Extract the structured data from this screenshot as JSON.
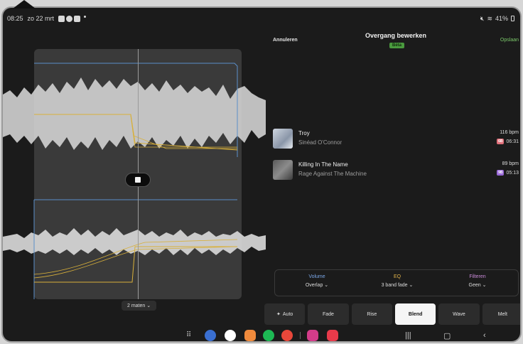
{
  "status": {
    "time": "08:25",
    "date": "zo 22 mrt",
    "battery": "41%"
  },
  "header": {
    "cancel": "Annuleren",
    "title": "Overgang bewerken",
    "beta": "Bèta",
    "save": "Opslaan"
  },
  "tracks": [
    {
      "title": "Troy",
      "artist": "Sinéad O'Connor",
      "bpm": "116 bpm",
      "key": "6B",
      "key_color": "#e0707a",
      "duration": "06:31"
    },
    {
      "title": "Killing In The Name",
      "artist": "Rage Against The Machine",
      "bpm": "89 bpm",
      "key": "9B",
      "key_color": "#9a6ad8",
      "duration": "05:13"
    }
  ],
  "settings": [
    {
      "label": "Volume",
      "value": "Overlap ⌄",
      "color": "#7aa6e6"
    },
    {
      "label": "EQ",
      "value": "3 band fade ⌄",
      "color": "#e0b24a"
    },
    {
      "label": "Filteren",
      "value": "Geen ⌄",
      "color": "#c98ad8"
    }
  ],
  "modes": [
    {
      "label": "Auto",
      "icon": "sparkle-icon",
      "active": false
    },
    {
      "label": "Fade",
      "active": false
    },
    {
      "label": "Rise",
      "active": false
    },
    {
      "label": "Blend",
      "active": true
    },
    {
      "label": "Wave",
      "active": false
    },
    {
      "label": "Melt",
      "active": false
    }
  ],
  "measures": "2 maten ⌄",
  "colors": {
    "save_accent": "#7bc96a",
    "waveform": "#d9d9d9",
    "eq_line": "#d8b03a",
    "volume_line": "#5b8fc9"
  }
}
